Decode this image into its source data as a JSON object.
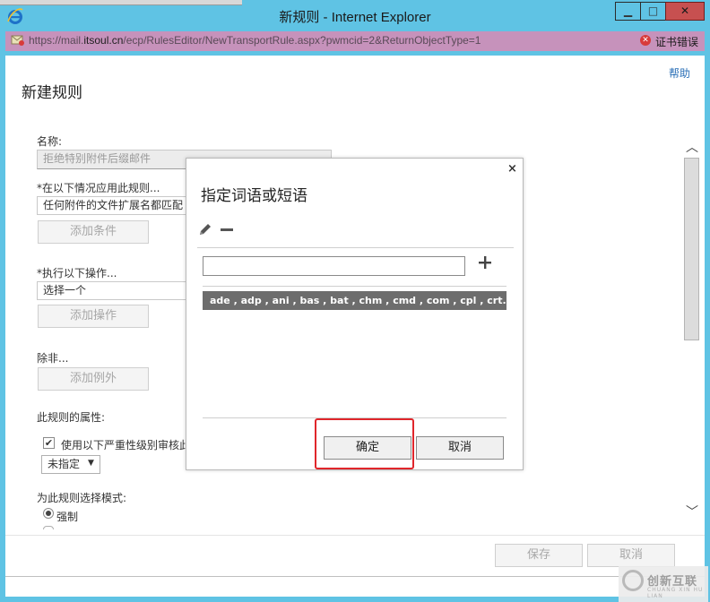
{
  "window": {
    "title": "新规则 - Internet Explorer",
    "min_glyph": "▁",
    "max_glyph": "□",
    "close_glyph": "✕"
  },
  "address_bar": {
    "url_prefix": "https://mail.",
    "url_domain": "itsoul.cn",
    "url_rest": "/ecp/RulesEditor/NewTransportRule.aspx?pwmcid=2&ReturnObjectType=1",
    "cert_error": "证书错误",
    "cert_icon_glyph": "✕"
  },
  "page": {
    "help": "帮助",
    "title": "新建规则",
    "name_label": "名称:",
    "name_value": "拒绝特别附件后缀邮件",
    "apply_label": "*在以下情况应用此规则...",
    "apply_value": "任何附件的文件扩展名都匹配",
    "add_condition": "添加条件",
    "do_label": "*执行以下操作...",
    "do_value": "选择一个",
    "add_action": "添加操作",
    "except_label": "除非...",
    "add_exception": "添加例外",
    "props_label": "此规则的属性:",
    "severity_checkbox_label": "使用以下严重性级别审核此",
    "severity_value": "未指定",
    "mode_label": "为此规则选择模式:",
    "mode_enforce": "强制",
    "save": "保存",
    "cancel": "取消",
    "scroll_up_glyph": "︿",
    "scroll_down_glyph": "﹀"
  },
  "dialog": {
    "title": "指定词语或短语",
    "close_glyph": "×",
    "input_value": "",
    "list_items": [
      "ade , adp , ani , bas , bat , chm , cmd , com , cpl , crt..."
    ],
    "ok": "确定",
    "cancel": "取消"
  },
  "watermark": {
    "text": "创新互联",
    "sub": "CHUANG XIN HU LIAN"
  }
}
